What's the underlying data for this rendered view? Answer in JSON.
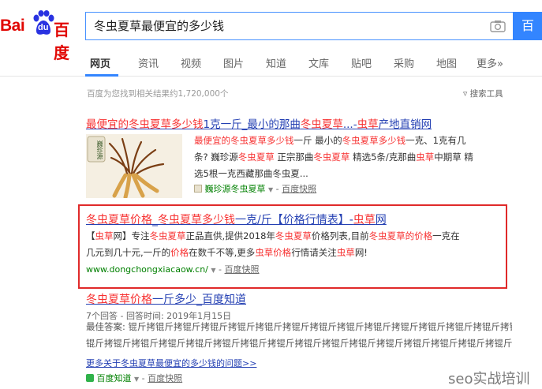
{
  "header": {
    "logo_bai": "Bai",
    "logo_du": "du",
    "logo_baidu": "百度",
    "query": "冬虫夏草最便宜的多少钱",
    "search_button": "百",
    "camera_icon": "camera-icon"
  },
  "tabs": [
    "网页",
    "资讯",
    "视频",
    "图片",
    "知道",
    "文库",
    "贴吧",
    "采购",
    "地图",
    "更多»"
  ],
  "stats": "百度为您找到相关结果约1,720,000个",
  "tools": "搜索工具",
  "result1": {
    "title_parts": [
      "最便宜的",
      "冬虫夏草",
      "多少钱",
      "1克一斤_最小的那曲",
      "冬虫夏草",
      "...-",
      "虫草",
      "产地直销网"
    ],
    "thumb_label": "巍珍源",
    "abstract": [
      [
        "最便宜的",
        "冬虫夏草多少钱",
        "一斤 最小的",
        "冬虫夏草多少钱",
        "一克、1克有几"
      ],
      [
        "条? 巍珍源",
        "冬虫夏草",
        " 正宗那曲",
        "冬虫夏草",
        " 精选5条/克那曲",
        "虫草",
        "中期草 精"
      ],
      [
        "选5根一克西藏那曲冬虫夏..."
      ]
    ],
    "site_name": "巍珍源冬虫夏草",
    "cache": "百度快照"
  },
  "result2": {
    "title_parts": [
      "冬虫夏草价格",
      "_",
      "冬虫夏草多少钱",
      "一克/斤【价格行情表】-",
      "虫草",
      "网"
    ],
    "abstract": [
      [
        "【",
        "虫草",
        "网】专注",
        "冬虫夏草",
        "正品直供,提供2018年",
        "冬虫夏草",
        "价格列表,目前",
        "冬虫夏草的价格",
        "一克在"
      ],
      [
        "几元到几十元,一斤的",
        "价格",
        "在数千不等,更多",
        "虫草价格",
        "行情请关注",
        "虫草",
        "网!"
      ]
    ],
    "url": "www.dongchongxiacaow.cn/",
    "cache": "百度快照"
  },
  "result3": {
    "title_parts": [
      "冬虫夏草价格",
      "一斤多少",
      "_百度知道"
    ],
    "meta": "7个回答 - 回答时间: 2019年1月15日",
    "abstract": [
      "最佳答案: 锟斤拷锟斤拷锟斤拷锟斤拷锟斤拷锟斤拷锟斤拷锟斤拷锟斤拷锟斤拷锟斤拷锟斤拷锟斤拷锟斤拷锟斤拷锟斤拷锟斤拷锟斤拷",
      "锟斤拷锟斤拷锟斤拷锟斤拷锟斤拷锟斤拷锟斤拷锟斤拷锟斤拷锟斤拷锟斤拷锟斤拷锟斤拷锟斤拷锟斤拷锟斤拷锟斤拷锟斤拷锟斤拷锟斤..."
    ],
    "more": "更多关于冬虫夏草最便宜的多少钱的问题>>",
    "site": "百度知道",
    "cache": "百度快照"
  },
  "watermark": "seo实战培训",
  "colors": {
    "brand_red": "#e10602",
    "link_blue": "#2440b3",
    "highlight_red": "#f73131",
    "url_green": "#008000",
    "box_red": "#e02a2a",
    "button_blue": "#3385ff"
  }
}
